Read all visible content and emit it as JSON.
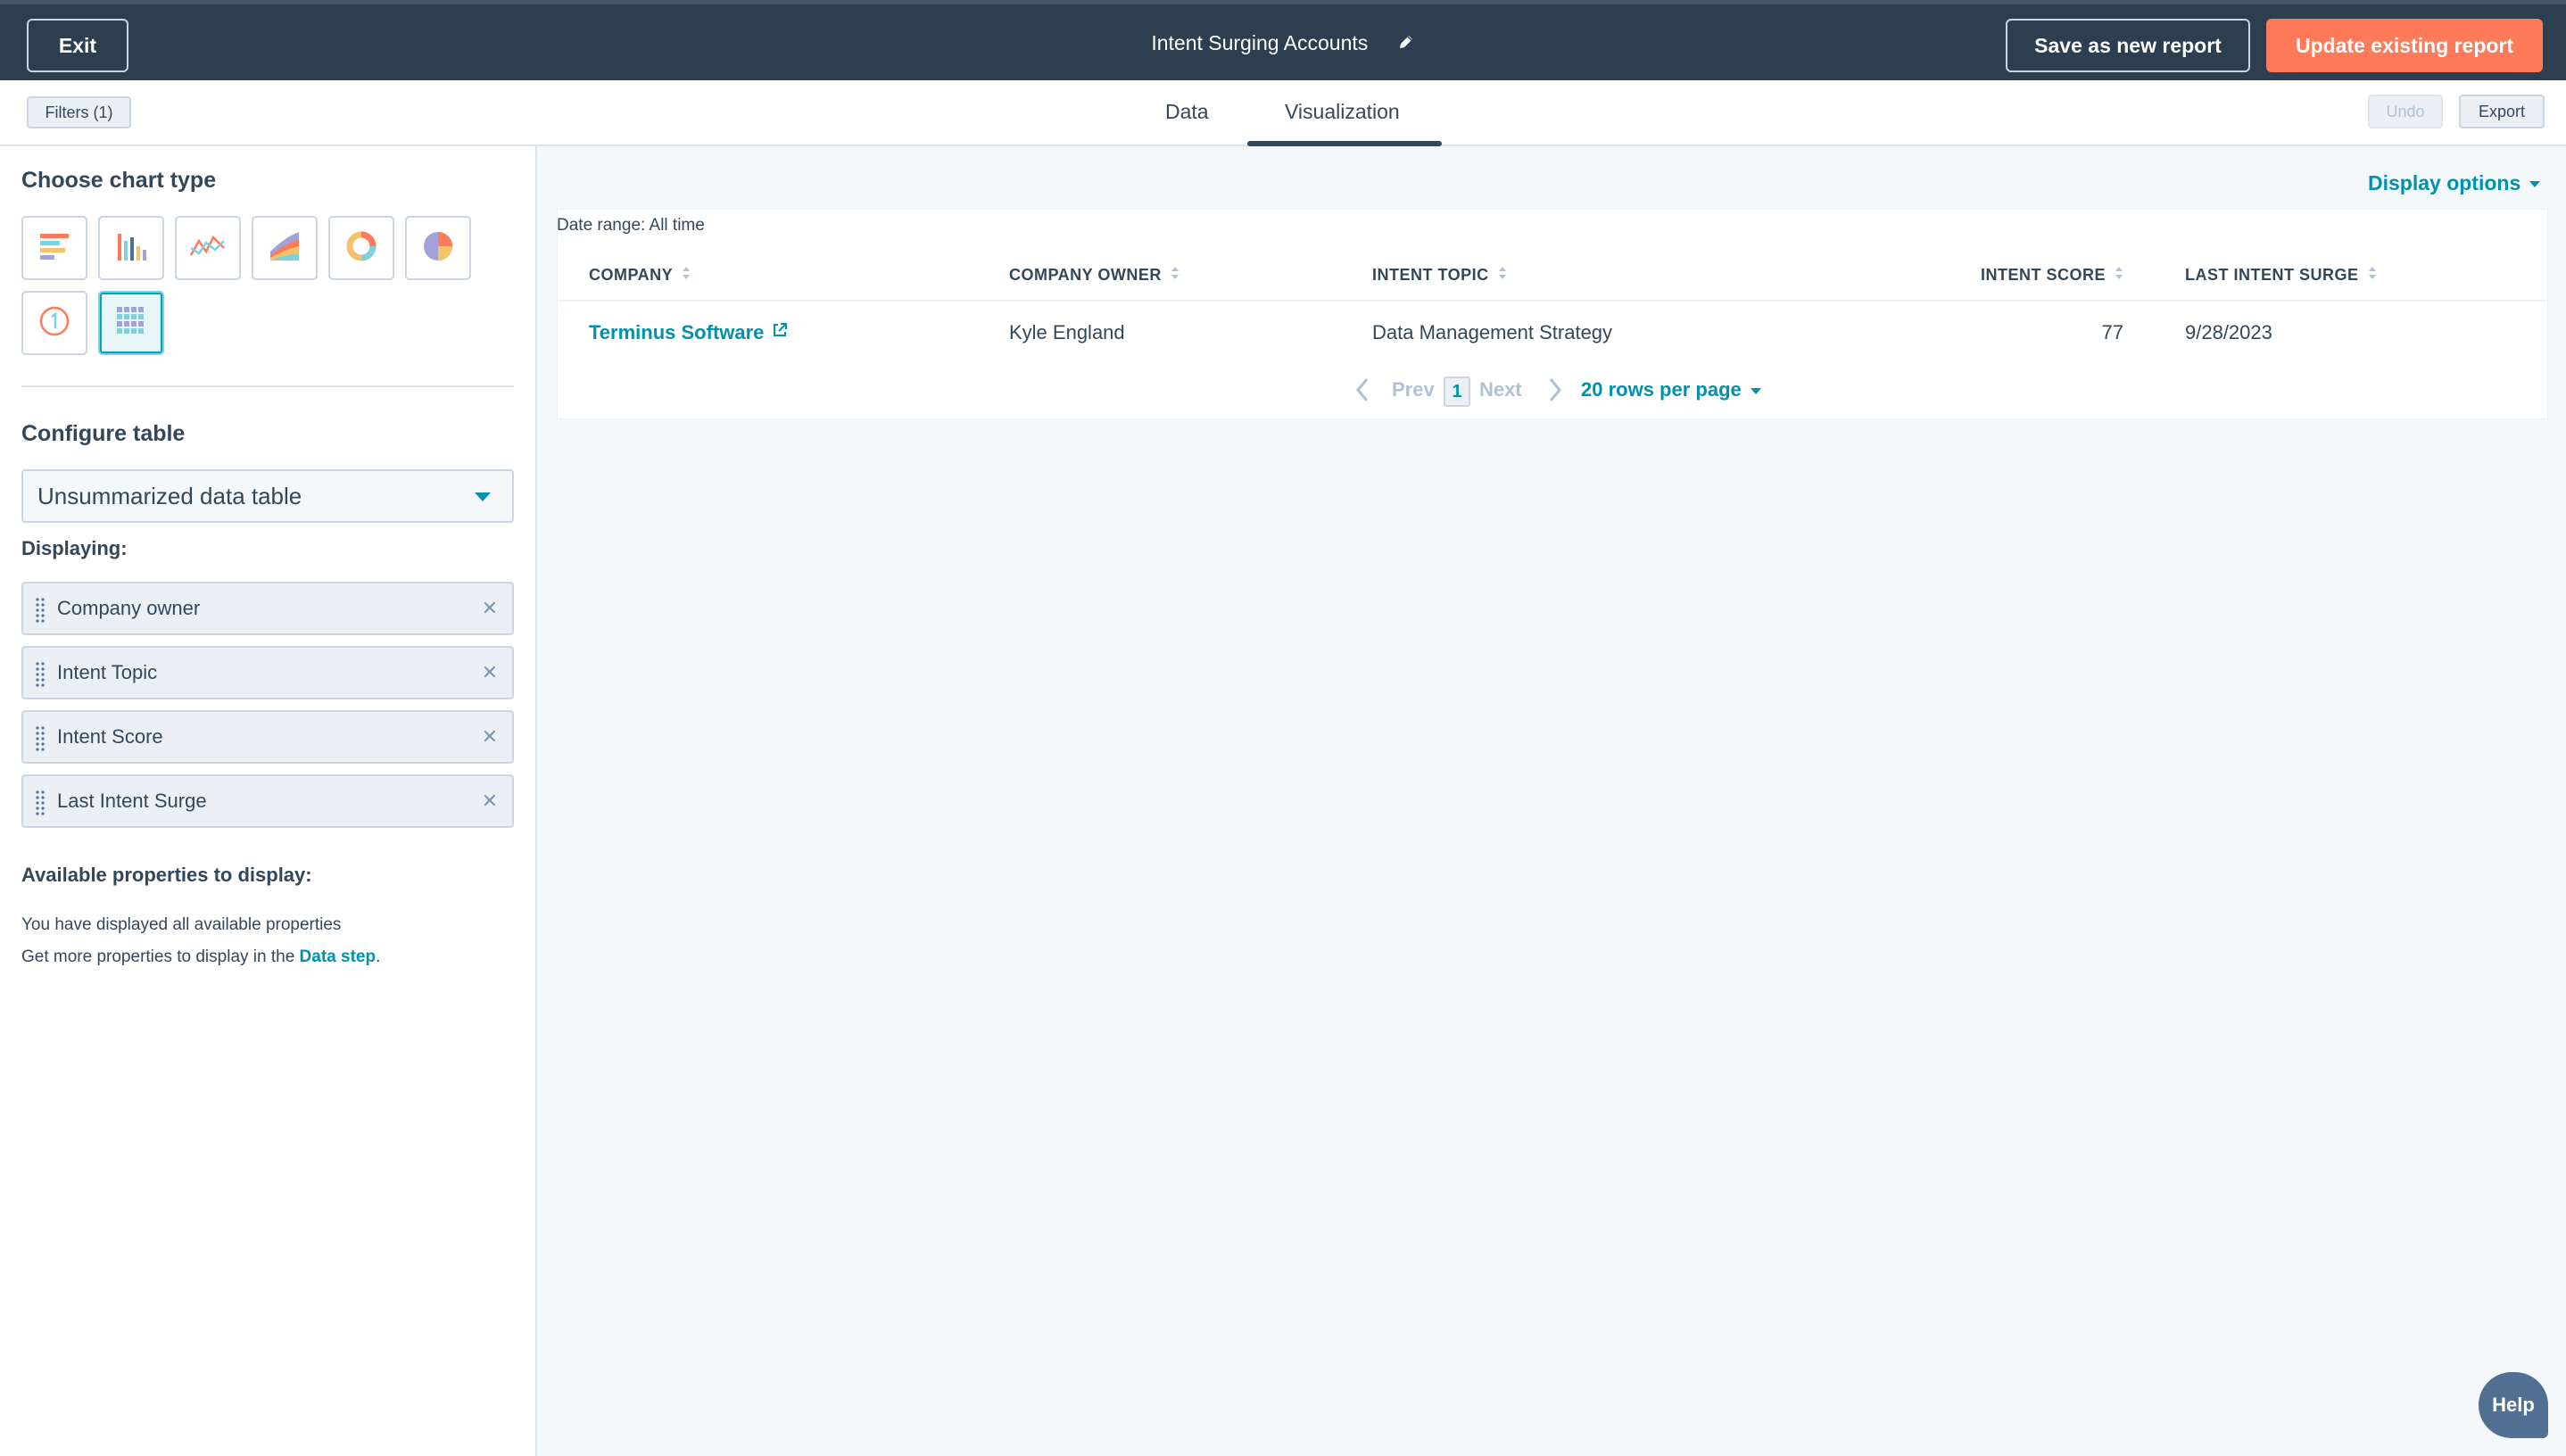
{
  "topbar": {
    "exit_label": "Exit",
    "report_title": "Intent Surging Accounts",
    "save_new_label": "Save as new report",
    "update_label": "Update existing report"
  },
  "subnav": {
    "filters_label": "Filters (1)",
    "tabs": [
      {
        "label": "Data",
        "active": false
      },
      {
        "label": "Visualization",
        "active": true
      }
    ],
    "undo_label": "Undo",
    "export_label": "Export"
  },
  "left_panel": {
    "choose_chart_title": "Choose chart type",
    "chart_types": [
      {
        "icon": "horizontal-bar-chart-icon",
        "selected": false
      },
      {
        "icon": "vertical-bar-chart-icon",
        "selected": false
      },
      {
        "icon": "line-chart-icon",
        "selected": false
      },
      {
        "icon": "area-chart-icon",
        "selected": false
      },
      {
        "icon": "donut-chart-icon",
        "selected": false
      },
      {
        "icon": "pie-chart-icon",
        "selected": false
      },
      {
        "icon": "kpi-number-icon",
        "selected": false
      },
      {
        "icon": "table-chart-icon",
        "selected": true
      }
    ],
    "configure_title": "Configure table",
    "table_type_value": "Unsummarized data table",
    "displaying_label": "Displaying:",
    "displayed_properties": [
      "Company owner",
      "Intent Topic",
      "Intent Score",
      "Last Intent Surge"
    ],
    "available_title": "Available properties to display:",
    "available_note": "You have displayed all available properties",
    "data_step_prefix": "Get more properties to display in the ",
    "data_step_link": "Data step",
    "data_step_suffix": "."
  },
  "main": {
    "display_options_label": "Display options",
    "date_range": "Date range: All time",
    "table": {
      "columns": [
        "COMPANY",
        "COMPANY OWNER",
        "INTENT TOPIC",
        "INTENT SCORE",
        "LAST INTENT SURGE"
      ],
      "rows": [
        {
          "company": "Terminus Software",
          "company_owner": "Kyle England",
          "intent_topic": "Data Management Strategy",
          "intent_score": "77",
          "last_intent_surge": "9/28/2023"
        }
      ]
    },
    "pagination": {
      "prev_label": "Prev",
      "current_page": "1",
      "next_label": "Next",
      "rows_per_page": "20 rows per page"
    }
  },
  "help_label": "Help",
  "colors": {
    "topbar_bg": "#2d3e50",
    "accent_orange": "#ff7a59",
    "link_teal": "#0091ae",
    "text_primary": "#33475b"
  }
}
